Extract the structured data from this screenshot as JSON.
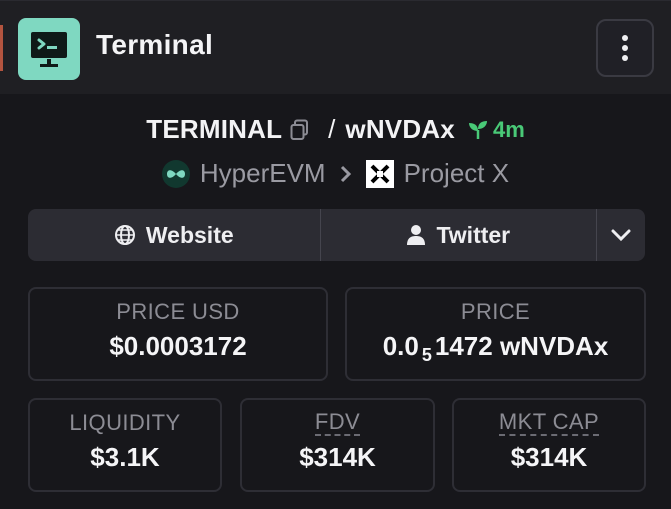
{
  "header": {
    "title": "Terminal",
    "icon": "terminal-icon",
    "menu_icon": "more-vertical-icon"
  },
  "token": {
    "symbol": "TERMINAL",
    "separator": "/",
    "quote": "wNVDAx",
    "age": "4m",
    "age_color": "#49c977"
  },
  "chain": {
    "network": "HyperEVM",
    "dex": "Project X"
  },
  "links": {
    "website": "Website",
    "twitter": "Twitter"
  },
  "stats": {
    "price_usd_label": "PRICE USD",
    "price_usd": "$0.0003172",
    "price_label": "PRICE",
    "price_lead": "0.0",
    "price_zero_count": "5",
    "price_tail": "1472 wNVDAx",
    "liquidity_label": "LIQUIDITY",
    "liquidity": "$3.1K",
    "fdv_label": "FDV",
    "fdv": "$314K",
    "mktcap_label": "MKT CAP",
    "mktcap": "$314K"
  },
  "colors": {
    "brand_icon_bg": "#7fd8c1",
    "accent_strip": "#b3543f",
    "background": "#17171b"
  }
}
